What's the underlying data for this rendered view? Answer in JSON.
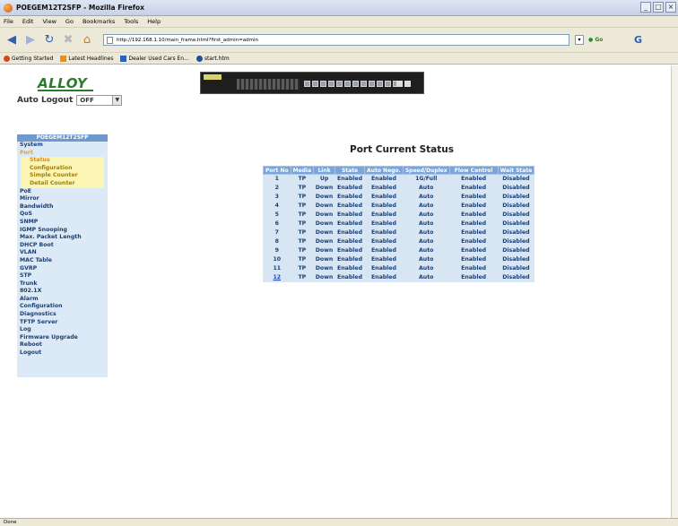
{
  "browser": {
    "window_title": "POEGEM12T2SFP - Mozilla Firefox",
    "menu": [
      "File",
      "Edit",
      "View",
      "Go",
      "Bookmarks",
      "Tools",
      "Help"
    ],
    "url": "http://192.168.1.10/main_frame.html?first_admin=admin",
    "go_label": "Go",
    "bookmarks": [
      "Getting Started",
      "Latest Headlines",
      "Dealer Used Cars En...",
      "start.htm"
    ],
    "status": "Done"
  },
  "header": {
    "logo_text": "ALLOY",
    "auto_logout_label": "Auto Logout",
    "auto_logout_value": "OFF"
  },
  "sidebar": {
    "model": "POEGEM12T2SFP",
    "items": [
      "System",
      "Port",
      "PoE",
      "Mirror",
      "Bandwidth",
      "QoS",
      "SNMP",
      "IGMP Snooping",
      "Max. Packet Length",
      "DHCP Boot",
      "VLAN",
      "MAC Table",
      "GVRP",
      "STP",
      "Trunk",
      "802.1X",
      "Alarm",
      "Configuration",
      "Diagnostics",
      "TFTP Server",
      "Log",
      "Firmware Upgrade",
      "Reboot",
      "Logout"
    ],
    "port_subitems": [
      "Status",
      "Configuration",
      "Simple Counter",
      "Detail Counter"
    ]
  },
  "main": {
    "title": "Port Current Status",
    "columns": [
      "Port No",
      "Media",
      "Link",
      "State",
      "Auto Nego.",
      "Speed/Duplex",
      "Flow Control",
      "Wait State"
    ],
    "rows": [
      [
        "1",
        "TP",
        "Up",
        "Enabled",
        "Enabled",
        "1G/Full",
        "Enabled",
        "Disabled"
      ],
      [
        "2",
        "TP",
        "Down",
        "Enabled",
        "Enabled",
        "Auto",
        "Enabled",
        "Disabled"
      ],
      [
        "3",
        "TP",
        "Down",
        "Enabled",
        "Enabled",
        "Auto",
        "Enabled",
        "Disabled"
      ],
      [
        "4",
        "TP",
        "Down",
        "Enabled",
        "Enabled",
        "Auto",
        "Enabled",
        "Disabled"
      ],
      [
        "5",
        "TP",
        "Down",
        "Enabled",
        "Enabled",
        "Auto",
        "Enabled",
        "Disabled"
      ],
      [
        "6",
        "TP",
        "Down",
        "Enabled",
        "Enabled",
        "Auto",
        "Enabled",
        "Disabled"
      ],
      [
        "7",
        "TP",
        "Down",
        "Enabled",
        "Enabled",
        "Auto",
        "Enabled",
        "Disabled"
      ],
      [
        "8",
        "TP",
        "Down",
        "Enabled",
        "Enabled",
        "Auto",
        "Enabled",
        "Disabled"
      ],
      [
        "9",
        "TP",
        "Down",
        "Enabled",
        "Enabled",
        "Auto",
        "Enabled",
        "Disabled"
      ],
      [
        "10",
        "TP",
        "Down",
        "Enabled",
        "Enabled",
        "Auto",
        "Enabled",
        "Disabled"
      ],
      [
        "11",
        "TP",
        "Down",
        "Enabled",
        "Enabled",
        "Auto",
        "Enabled",
        "Disabled"
      ],
      [
        "12",
        "TP",
        "Down",
        "Enabled",
        "Enabled",
        "Auto",
        "Enabled",
        "Disabled"
      ]
    ]
  },
  "colors": {
    "sidebar_bg": "#dce9f6",
    "table_header": "#7ba5d8",
    "accent_port": "#e8a21b",
    "logo_green": "#2b7a2b"
  }
}
